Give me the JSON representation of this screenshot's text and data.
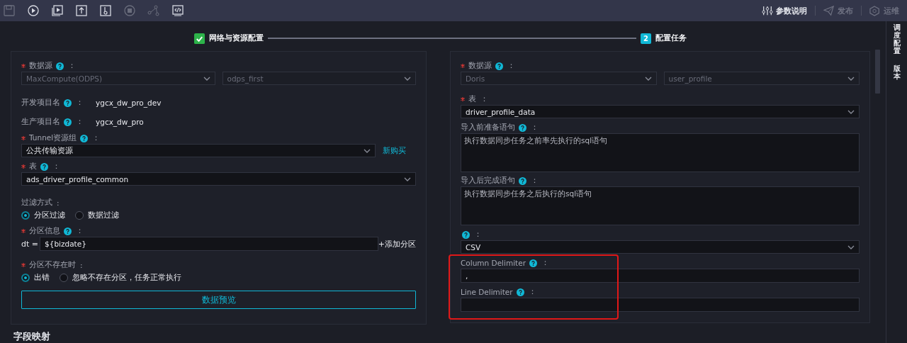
{
  "toolbar": {
    "tools": [
      {
        "disabled": true
      },
      {
        "disabled": false
      },
      {
        "disabled": false
      },
      {
        "disabled": false
      },
      {
        "disabled": false
      },
      {
        "disabled": true
      },
      {
        "disabled": true
      },
      {
        "disabled": false
      }
    ],
    "actions": [
      {
        "label": "参数说明",
        "disabled": false
      },
      {
        "label": "发布",
        "disabled": true
      },
      {
        "label": "运维",
        "disabled": true
      }
    ]
  },
  "steps": [
    {
      "done": true,
      "label": "网络与资源配置"
    },
    {
      "done": false,
      "number": "2",
      "label": "配置任务"
    }
  ],
  "source_form": [
    {
      "kind": "select-pair",
      "required": true,
      "label": "数据源",
      "help": true,
      "suffix": "：",
      "values": [
        "MaxCompute(ODPS)",
        "odps_first"
      ],
      "disabled": true
    },
    {
      "kind": "info",
      "required": false,
      "label": "开发项目名",
      "help": true,
      "suffix": "：",
      "value": "ygcx_dw_pro_dev"
    },
    {
      "kind": "info",
      "required": false,
      "label": "生产项目名",
      "help": true,
      "suffix": "：",
      "value": "ygcx_dw_pro"
    },
    {
      "kind": "select",
      "required": true,
      "label": "Tunnel资源组",
      "help": true,
      "suffix": "：",
      "value": "公共传输资源",
      "link": "新购买"
    },
    {
      "kind": "select",
      "required": true,
      "label": "表",
      "help": true,
      "suffix": "：",
      "value": "ads_driver_profile_common"
    },
    {
      "kind": "radios",
      "required": false,
      "label": "过滤方式",
      "help": false,
      "suffix": ":",
      "options": [
        {
          "label": "分区过滤",
          "selected": true
        },
        {
          "label": "数据过滤",
          "selected": false
        }
      ]
    },
    {
      "kind": "partition",
      "required": true,
      "label": "分区信息",
      "help": true,
      "suffix": "：",
      "prefix": "dt =",
      "value": "${bizdate}",
      "link": "+添加分区"
    },
    {
      "kind": "radios",
      "required": true,
      "label": "分区不存在时",
      "help": false,
      "suffix": ":",
      "options": [
        {
          "label": "出错",
          "selected": true
        },
        {
          "label": "忽略不存在分区，任务正常执行",
          "selected": false
        }
      ]
    },
    {
      "kind": "button",
      "label": "数据预览"
    }
  ],
  "target_form": [
    {
      "kind": "select-pair",
      "required": true,
      "label": "数据源",
      "help": true,
      "suffix": "：",
      "values": [
        "Doris",
        "user_profile"
      ],
      "disabled": true
    },
    {
      "kind": "select",
      "required": true,
      "label": "表",
      "help": false,
      "suffix": "：",
      "value": "driver_profile_data"
    },
    {
      "kind": "textarea",
      "required": false,
      "label": "导入前准备语句",
      "help": true,
      "suffix": "：",
      "placeholder": "执行数据同步任务之前率先执行的sql语句"
    },
    {
      "kind": "textarea",
      "required": false,
      "label": "导入后完成语句",
      "help": true,
      "suffix": "：",
      "placeholder": "执行数据同步任务之后执行的sql语句"
    },
    {
      "kind": "select",
      "required": false,
      "help": true,
      "suffix": "：",
      "value": "CSV"
    },
    {
      "kind": "input",
      "required": false,
      "label": "Column Delimiter",
      "help": true,
      "suffix": "：",
      "value": ","
    },
    {
      "kind": "input",
      "required": false,
      "label": "Line Delimiter",
      "help": true,
      "suffix": "："
    }
  ],
  "section_title": "字段映射",
  "side_tabs": [
    "调度配置",
    "版本"
  ]
}
